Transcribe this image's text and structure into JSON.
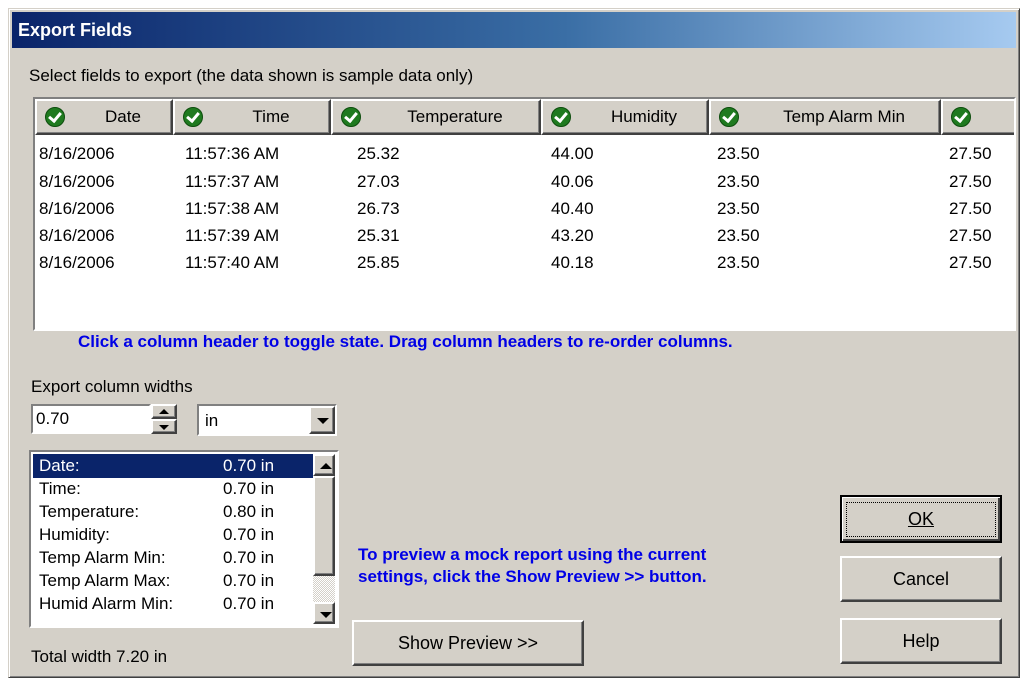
{
  "dialog": {
    "title": "Export Fields",
    "instructions": "Select fields to export (the data shown is sample data only)",
    "grid_hint": "Click a column header to toggle state. Drag column headers to re-order columns.",
    "preview_hint_line1": "To preview a mock report using the current",
    "preview_hint_line2": "settings, click the Show Preview >> button."
  },
  "grid": {
    "columns": [
      "Date",
      "Time",
      "Temperature",
      "Humidity",
      "Temp Alarm Min",
      ""
    ],
    "rows": [
      [
        "8/16/2006",
        "11:57:36 AM",
        "25.32",
        "44.00",
        "23.50",
        "27.50"
      ],
      [
        "8/16/2006",
        "11:57:37 AM",
        "27.03",
        "40.06",
        "23.50",
        "27.50"
      ],
      [
        "8/16/2006",
        "11:57:38 AM",
        "26.73",
        "40.40",
        "23.50",
        "27.50"
      ],
      [
        "8/16/2006",
        "11:57:39 AM",
        "25.31",
        "43.20",
        "23.50",
        "27.50"
      ],
      [
        "8/16/2006",
        "11:57:40 AM",
        "25.85",
        "40.18",
        "23.50",
        "27.50"
      ]
    ]
  },
  "widths": {
    "label": "Export column widths",
    "value": "0.70",
    "unit": "in",
    "items": [
      {
        "name": "Date:",
        "width": "0.70 in"
      },
      {
        "name": "Time:",
        "width": "0.70 in"
      },
      {
        "name": "Temperature:",
        "width": "0.80 in"
      },
      {
        "name": "Humidity:",
        "width": "0.70 in"
      },
      {
        "name": "Temp Alarm Min:",
        "width": "0.70 in"
      },
      {
        "name": "Temp Alarm Max:",
        "width": "0.70 in"
      },
      {
        "name": "Humid Alarm Min:",
        "width": "0.70 in"
      }
    ],
    "total": "Total width 7.20 in"
  },
  "buttons": {
    "ok": "OK",
    "cancel": "Cancel",
    "help": "Help",
    "show_preview": "Show Preview >>"
  },
  "colors": {
    "dialog_bg": "#d4d0c8",
    "title_gradient_start": "#0a246a",
    "title_gradient_end": "#a6caf0",
    "hint_text": "#0000e6",
    "selection_bg": "#0a246a",
    "check_green": "#1f7a1f"
  },
  "icons": [
    "check-icon",
    "scroll-left-icon",
    "scroll-right-icon",
    "spin-up-icon",
    "spin-down-icon",
    "dropdown-arrow-icon",
    "scroll-up-icon",
    "scroll-down-icon"
  ]
}
